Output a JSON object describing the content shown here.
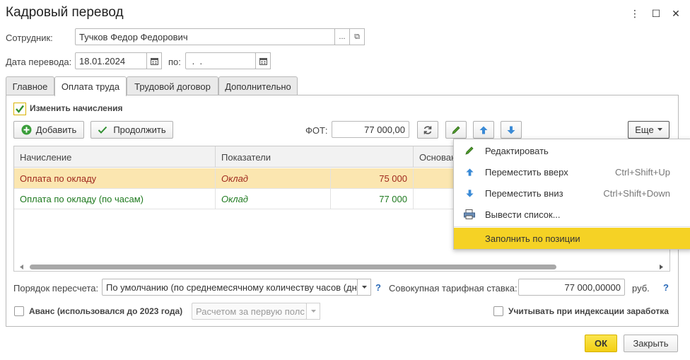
{
  "window": {
    "title": "Кадровый перевод",
    "more_symbol": "⋮",
    "maximize_symbol": "☐",
    "close_symbol": "✕"
  },
  "employee": {
    "label": "Сотрудник:",
    "value": "Тучков Федор Федорович",
    "ellipsis": "...",
    "open_symbol": "⧉"
  },
  "date": {
    "label": "Дата перевода:",
    "value": "18.01.2024",
    "to_label": "по:",
    "to_value": " .  ."
  },
  "tabs": [
    {
      "label": "Главное"
    },
    {
      "label": "Оплата труда"
    },
    {
      "label": "Трудовой договор"
    },
    {
      "label": "Дополнительно"
    }
  ],
  "accruals": {
    "change_label": "Изменить начисления",
    "add_label": "Добавить",
    "continue_label": "Продолжить",
    "fot_label": "ФОТ:",
    "fot_value": "77 000,00",
    "more_label": "Еще"
  },
  "grid": {
    "columns": [
      "Начисление",
      "Показатели",
      "Основан"
    ],
    "rows": [
      {
        "name": "Оплата по окладу",
        "indicator": "Оклад",
        "value": "75 000"
      },
      {
        "name": "Оплата по окладу (по часам)",
        "indicator": "Оклад",
        "value": "77 000"
      }
    ]
  },
  "menu": {
    "items": [
      {
        "label": "Редактировать",
        "shortcut": "",
        "icon": "pencil-icon"
      },
      {
        "label": "Переместить вверх",
        "shortcut": "Ctrl+Shift+Up",
        "icon": "arrow-up-icon"
      },
      {
        "label": "Переместить вниз",
        "shortcut": "Ctrl+Shift+Down",
        "icon": "arrow-down-icon"
      },
      {
        "label": "Вывести список...",
        "shortcut": "",
        "icon": "print-list-icon"
      },
      {
        "label": "Заполнить по позиции",
        "shortcut": "",
        "icon": ""
      }
    ]
  },
  "recalc": {
    "label": "Порядок пересчета:",
    "value": "По умолчанию (по среднемесячному количеству часов (дн",
    "help": "?",
    "rate_label": "Совокупная тарифная ставка:",
    "rate_value": "77 000,00000",
    "rate_unit": "руб.",
    "rate_help": "?"
  },
  "advance": {
    "label": "Аванс (использовался до 2023 года)",
    "select_value": "Расчетом за первую полс",
    "index_label": "Учитывать при индексации заработка"
  },
  "footer": {
    "ok_label": "ОК",
    "close_label": "Закрыть"
  },
  "colors": {
    "accent": "#f5d225",
    "selected_row": "#fbe6b0",
    "row1_text": "#a0291e",
    "row2_text": "#1f7a1f",
    "check_green": "#2f8f2f",
    "arrow_blue": "#3a8ad6"
  }
}
